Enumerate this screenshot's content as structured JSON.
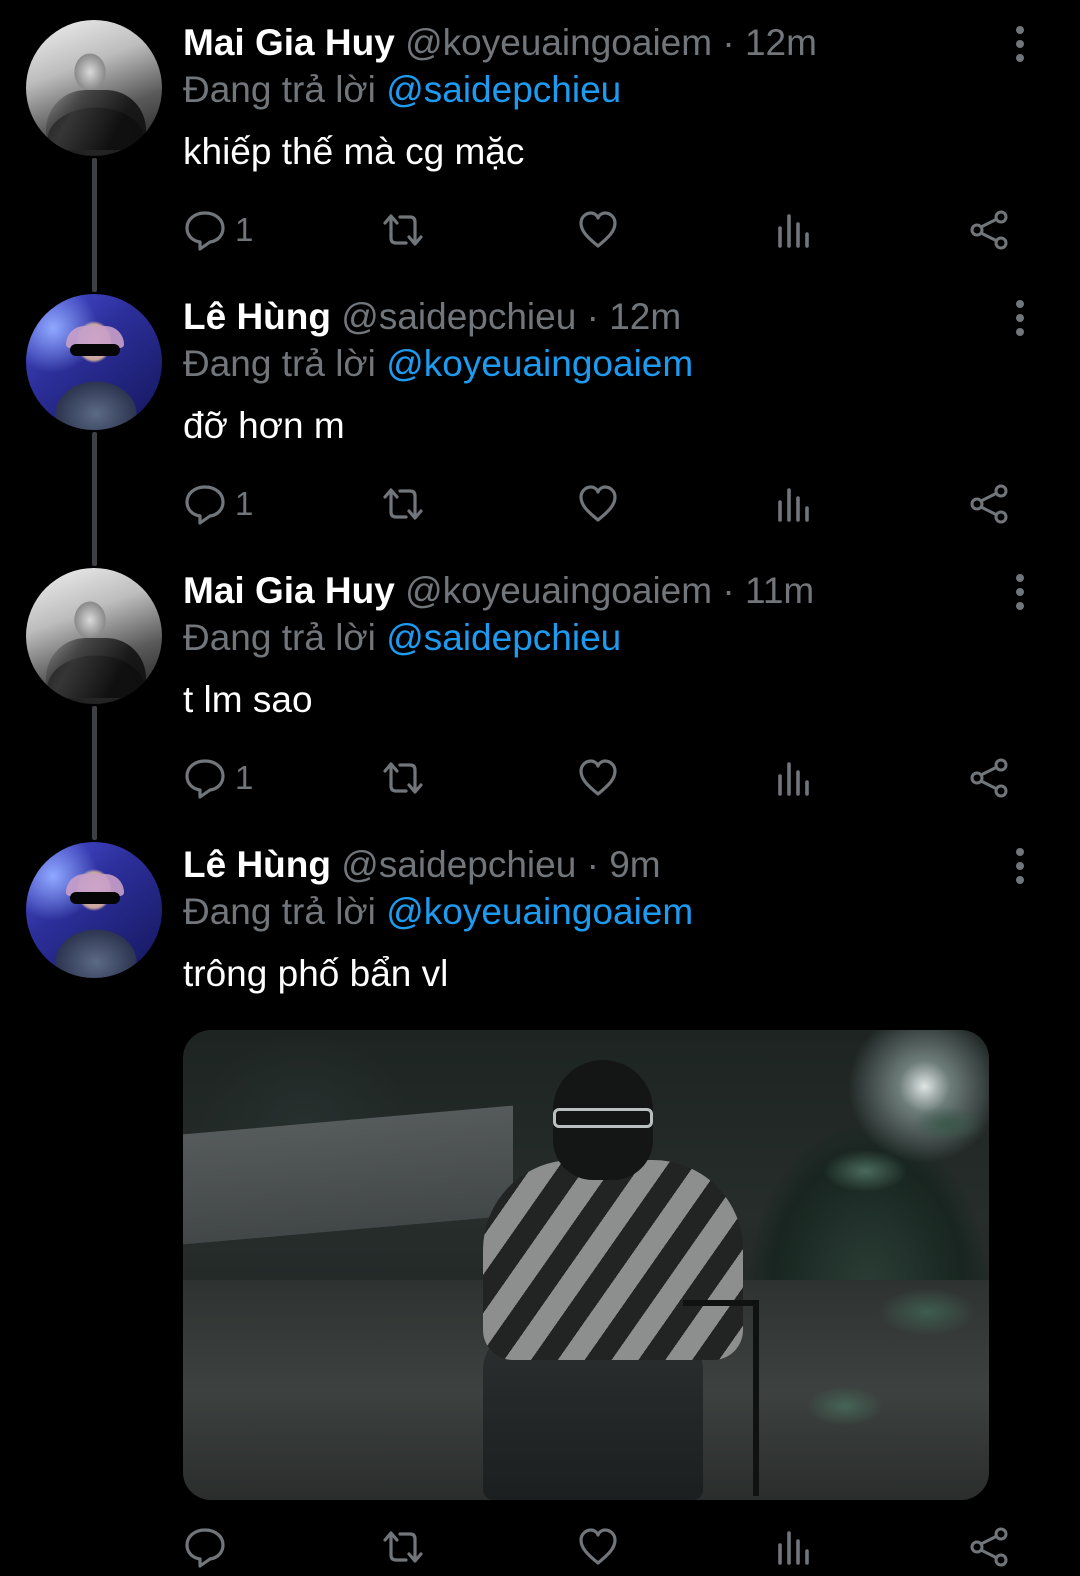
{
  "tweets": [
    {
      "name": "Mai Gia Huy",
      "handle": "@koyeuaingoaiem",
      "dot": "·",
      "time": "12m",
      "reply_prefix": "Đang trả lời",
      "reply_to": "@saidepchieu",
      "text": "khiếp thế mà cg mặc",
      "reply_count": "1",
      "avatar": "avatar-mono"
    },
    {
      "name": "Lê Hùng",
      "handle": "@saidepchieu",
      "dot": "·",
      "time": "12m",
      "reply_prefix": "Đang trả lời",
      "reply_to": "@koyeuaingoaiem",
      "text": "đỡ hơn m",
      "reply_count": "1",
      "avatar": "avatar-blue"
    },
    {
      "name": "Mai Gia Huy",
      "handle": "@koyeuaingoaiem",
      "dot": "·",
      "time": "11m",
      "reply_prefix": "Đang trả lời",
      "reply_to": "@saidepchieu",
      "text": "t lm sao",
      "reply_count": "1",
      "avatar": "avatar-mono"
    },
    {
      "name": "Lê Hùng",
      "handle": "@saidepchieu",
      "dot": "·",
      "time": "9m",
      "reply_prefix": "Đang trả lời",
      "reply_to": "@koyeuaingoaiem",
      "text": "trông phố bẩn vl",
      "reply_count": "",
      "avatar": "avatar-blue",
      "has_media": true
    }
  ],
  "icons": {
    "reply": "reply-icon",
    "retweet": "retweet-icon",
    "like": "heart-icon",
    "views": "views-icon",
    "share": "share-icon",
    "more": "more-vertical-icon"
  },
  "colors": {
    "background": "#000000",
    "name": "#ffffff",
    "muted": "#71767b",
    "mention": "#1d9bf0",
    "thread_line": "#3e4144"
  }
}
